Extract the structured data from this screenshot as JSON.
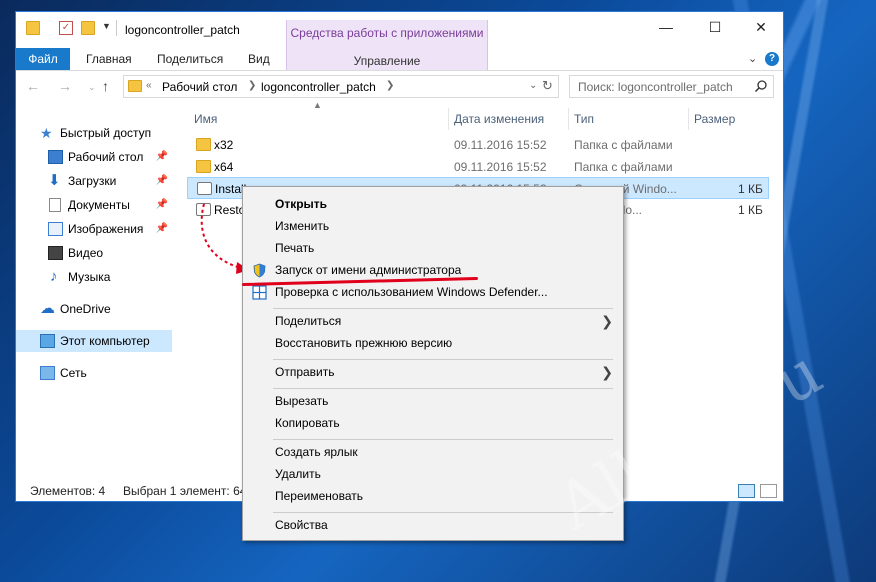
{
  "window": {
    "title": "logoncontroller_patch",
    "controls": {
      "minimize": "—",
      "maximize": "☐",
      "close": "✕"
    }
  },
  "ribbon": {
    "tabs": [
      "Файл",
      "Главная",
      "Поделиться",
      "Вид"
    ],
    "contextual_group": "Средства работы с приложениями",
    "contextual_tab": "Управление"
  },
  "address": {
    "prefix": "«",
    "breadcrumb": [
      "Рабочий стол",
      "logoncontroller_patch"
    ],
    "search_placeholder": "Поиск: logoncontroller_patch"
  },
  "sidebar": {
    "items": [
      {
        "label": "Быстрый доступ",
        "icon": "star-icon",
        "pinned": false
      },
      {
        "label": "Рабочий стол",
        "icon": "desktop-icon",
        "pinned": true
      },
      {
        "label": "Загрузки",
        "icon": "downloads-icon",
        "pinned": true
      },
      {
        "label": "Документы",
        "icon": "documents-icon",
        "pinned": true
      },
      {
        "label": "Изображения",
        "icon": "pictures-icon",
        "pinned": true
      },
      {
        "label": "Видео",
        "icon": "video-icon",
        "pinned": false
      },
      {
        "label": "Музыка",
        "icon": "music-icon",
        "pinned": false
      },
      {
        "label": "OneDrive",
        "icon": "cloud-icon",
        "pinned": false
      },
      {
        "label": "Этот компьютер",
        "icon": "computer-icon",
        "pinned": false
      },
      {
        "label": "Сеть",
        "icon": "network-icon",
        "pinned": false
      }
    ]
  },
  "file_list": {
    "columns": [
      "Имя",
      "Дата изменения",
      "Тип",
      "Размер"
    ],
    "rows": [
      {
        "name": "x32",
        "date": "09.11.2016 15:52",
        "type": "Папка с файлами",
        "size": ""
      },
      {
        "name": "x64",
        "date": "09.11.2016 15:52",
        "type": "Папка с файлами",
        "size": ""
      },
      {
        "name": "Install",
        "date": "09.11.2016 15:52",
        "type": "Сценарий Windo...",
        "size": "1 КБ"
      },
      {
        "name": "Resto",
        "date": "",
        "type": "...Windo...",
        "size": "1 КБ"
      }
    ]
  },
  "status": {
    "items_count": "Элементов: 4",
    "selected": "Выбран 1 элемент: 64"
  },
  "context_menu": {
    "items": [
      {
        "label": "Открыть",
        "bold": true
      },
      {
        "label": "Изменить"
      },
      {
        "label": "Печать"
      },
      {
        "label": "Запуск от имени администратора",
        "icon": "uac-shield-icon"
      },
      {
        "label": "Проверка с использованием Windows Defender...",
        "icon": "defender-icon"
      },
      {
        "label": "Поделиться",
        "submenu": "❯"
      },
      {
        "label": "Восстановить прежнюю версию"
      },
      {
        "label": "Отправить",
        "submenu": "❯"
      },
      {
        "label": "Вырезать"
      },
      {
        "label": "Копировать"
      },
      {
        "label": "Создать ярлык"
      },
      {
        "label": "Удалить"
      },
      {
        "label": "Переименовать"
      },
      {
        "label": "Свойства"
      }
    ]
  },
  "watermark": "All4os.ru",
  "colors": {
    "accent": "#1979ca",
    "selection": "#cce8ff",
    "annotation_red": "#e0001c",
    "contextual_tab": "#efe3f7"
  }
}
